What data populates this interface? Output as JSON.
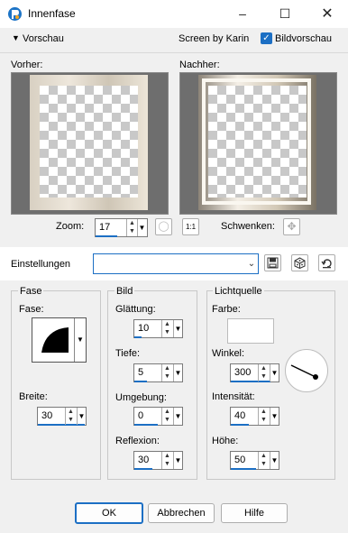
{
  "window": {
    "title": "Innenfase"
  },
  "preview": {
    "toggle_label": "Vorschau",
    "credit": "Screen by Karin",
    "live_preview_label": "Bildvorschau",
    "before_label": "Vorher:",
    "after_label": "Nachher:"
  },
  "zoom": {
    "label": "Zoom:",
    "value": "17"
  },
  "pan": {
    "label": "Schwenken:"
  },
  "settings": {
    "label": "Einstellungen",
    "preset_value": ""
  },
  "fase": {
    "group_label": "Fase",
    "shape_label": "Fase:",
    "width_label": "Breite:",
    "width_value": "30"
  },
  "bild": {
    "group_label": "Bild",
    "smoothing_label": "Glättung:",
    "smoothing_value": "10",
    "depth_label": "Tiefe:",
    "depth_value": "5",
    "ambience_label": "Umgebung:",
    "ambience_value": "0",
    "reflection_label": "Reflexion:",
    "reflection_value": "30"
  },
  "light": {
    "group_label": "Lichtquelle",
    "color_label": "Farbe:",
    "color_value": "#ffffff",
    "angle_label": "Winkel:",
    "angle_value": "300",
    "intensity_label": "Intensität:",
    "intensity_value": "40",
    "elevation_label": "Höhe:",
    "elevation_value": "50"
  },
  "buttons": {
    "ok": "OK",
    "cancel": "Abbrechen",
    "help": "Hilfe"
  }
}
